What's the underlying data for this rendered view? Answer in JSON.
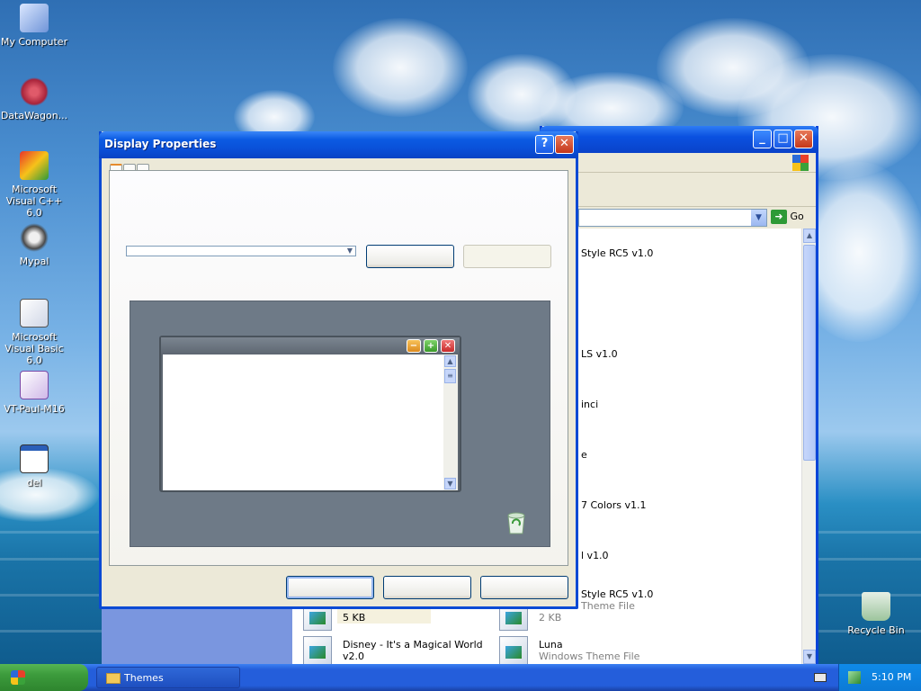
{
  "desktop": {
    "icons": [
      {
        "label": "My Computer"
      },
      {
        "label": "DataWagon..."
      },
      {
        "label": "Microsoft Visual C++ 6.0"
      },
      {
        "label": "Mypal"
      },
      {
        "label": "Microsoft Visual Basic 6.0"
      },
      {
        "label": "VT-Paul-M16"
      },
      {
        "label": "del"
      },
      {
        "label": "Recycle Bin"
      }
    ]
  },
  "dialog": {
    "title": "Display Properties",
    "help_button": "?",
    "close_button": "✕",
    "theme_select": {
      "value": ""
    },
    "save_as_label": "",
    "delete_label": "",
    "ok_label": "",
    "cancel_label": "",
    "apply_label": "",
    "preview": {
      "window_title": "",
      "minimize": "−",
      "maximize": "+",
      "close": "✕"
    }
  },
  "explorer": {
    "address_go": "Go",
    "items": [
      {
        "name": "Style RC5 v1.0"
      },
      {
        "name": "LS v1.0"
      },
      {
        "name": "inci"
      },
      {
        "name": "e"
      },
      {
        "name": "7 Colors v1.1"
      },
      {
        "name": "l v1.0"
      },
      {
        "name": "Style RC5 v1.0",
        "type": "Theme File"
      },
      {
        "size": "5 KB"
      },
      {
        "size": "2 KB"
      },
      {
        "name": "Disney - It's a Magical World v2.0"
      },
      {
        "name": "Luna",
        "type": "Windows Theme File"
      }
    ]
  },
  "taskbar": {
    "start_label": "",
    "task_themes": "Themes",
    "clock": "5:10 PM"
  },
  "colors": {
    "title_blue": "#0a4ed6",
    "dialog_face": "#ece9d8",
    "taskbar_blue": "#245edb",
    "start_green": "#3c9b3c"
  }
}
